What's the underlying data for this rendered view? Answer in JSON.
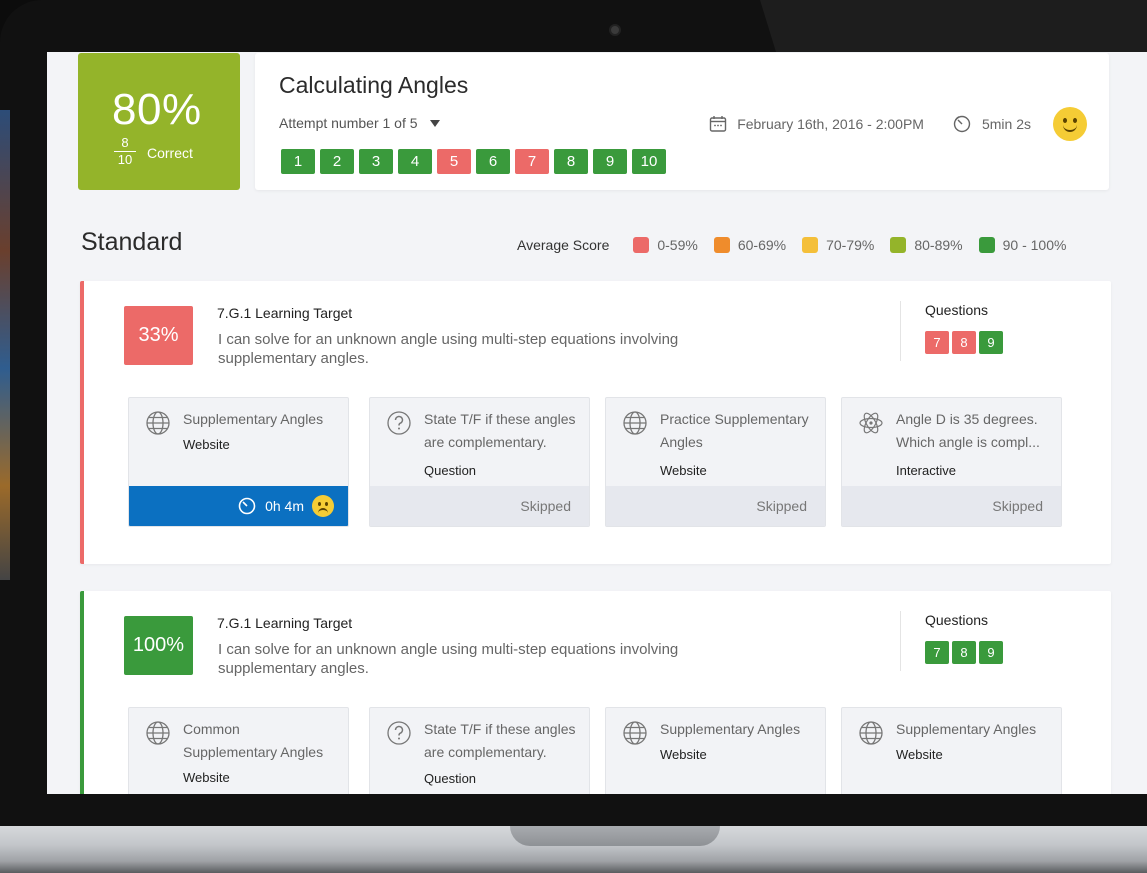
{
  "score": {
    "percent": "80%",
    "numerator": "8",
    "denominator": "10",
    "label": "Correct"
  },
  "quiz": {
    "title": "Calculating Angles",
    "attempt": "Attempt number 1 of 5",
    "date": "February 16th, 2016 - 2:00PM",
    "duration": "5min 2s",
    "questions": [
      {
        "n": "1",
        "status": "correct"
      },
      {
        "n": "2",
        "status": "correct"
      },
      {
        "n": "3",
        "status": "correct"
      },
      {
        "n": "4",
        "status": "correct"
      },
      {
        "n": "5",
        "status": "incorrect"
      },
      {
        "n": "6",
        "status": "correct"
      },
      {
        "n": "7",
        "status": "incorrect"
      },
      {
        "n": "8",
        "status": "correct"
      },
      {
        "n": "9",
        "status": "correct"
      },
      {
        "n": "10",
        "status": "correct"
      }
    ]
  },
  "standard": {
    "title": "Standard",
    "legend_label": "Average Score",
    "legend": [
      {
        "label": "0-59%",
        "color": "#ec6a68"
      },
      {
        "label": "60-69%",
        "color": "#ef8c2c"
      },
      {
        "label": "70-79%",
        "color": "#f4bf3a"
      },
      {
        "label": "80-89%",
        "color": "#94b42a"
      },
      {
        "label": "90 - 100%",
        "color": "#3a9a3c"
      }
    ]
  },
  "targets": [
    {
      "percent": "33%",
      "title": "7.G.1 Learning Target",
      "description": "I can solve for an unknown angle using multi-step equations involving supplementary angles.",
      "questions_label": "Questions",
      "questions": [
        {
          "n": "7",
          "status": "incorrect"
        },
        {
          "n": "8",
          "status": "incorrect"
        },
        {
          "n": "9",
          "status": "correct"
        }
      ],
      "resources": [
        {
          "icon": "globe-icon",
          "title": "Supplementary Angles",
          "type": "Website",
          "footer": "0h 4m"
        },
        {
          "icon": "question-icon",
          "title": "State T/F if these angles are complementary.",
          "type": "Question",
          "footer": "Skipped"
        },
        {
          "icon": "globe-icon",
          "title": "Practice Supplementary Angles",
          "type": "Website",
          "footer": "Skipped"
        },
        {
          "icon": "atom-icon",
          "title": "Angle D is 35 degrees. Which angle is compl...",
          "type": "Interactive",
          "footer": "Skipped"
        }
      ]
    },
    {
      "percent": "100%",
      "title": "7.G.1 Learning Target",
      "description": "I can solve for an unknown angle using multi-step equations involving supplementary angles.",
      "questions_label": "Questions",
      "questions": [
        {
          "n": "7",
          "status": "correct"
        },
        {
          "n": "8",
          "status": "correct"
        },
        {
          "n": "9",
          "status": "correct"
        }
      ],
      "resources": [
        {
          "icon": "globe-icon",
          "title": "Common Supplementary Angles",
          "type": "Website"
        },
        {
          "icon": "question-icon",
          "title": "State T/F if these angles are complementary.",
          "type": "Question"
        },
        {
          "icon": "globe-icon",
          "title": "Supplementary Angles",
          "type": "Website"
        },
        {
          "icon": "globe-icon",
          "title": "Supplementary Angles",
          "type": "Website"
        }
      ]
    }
  ]
}
